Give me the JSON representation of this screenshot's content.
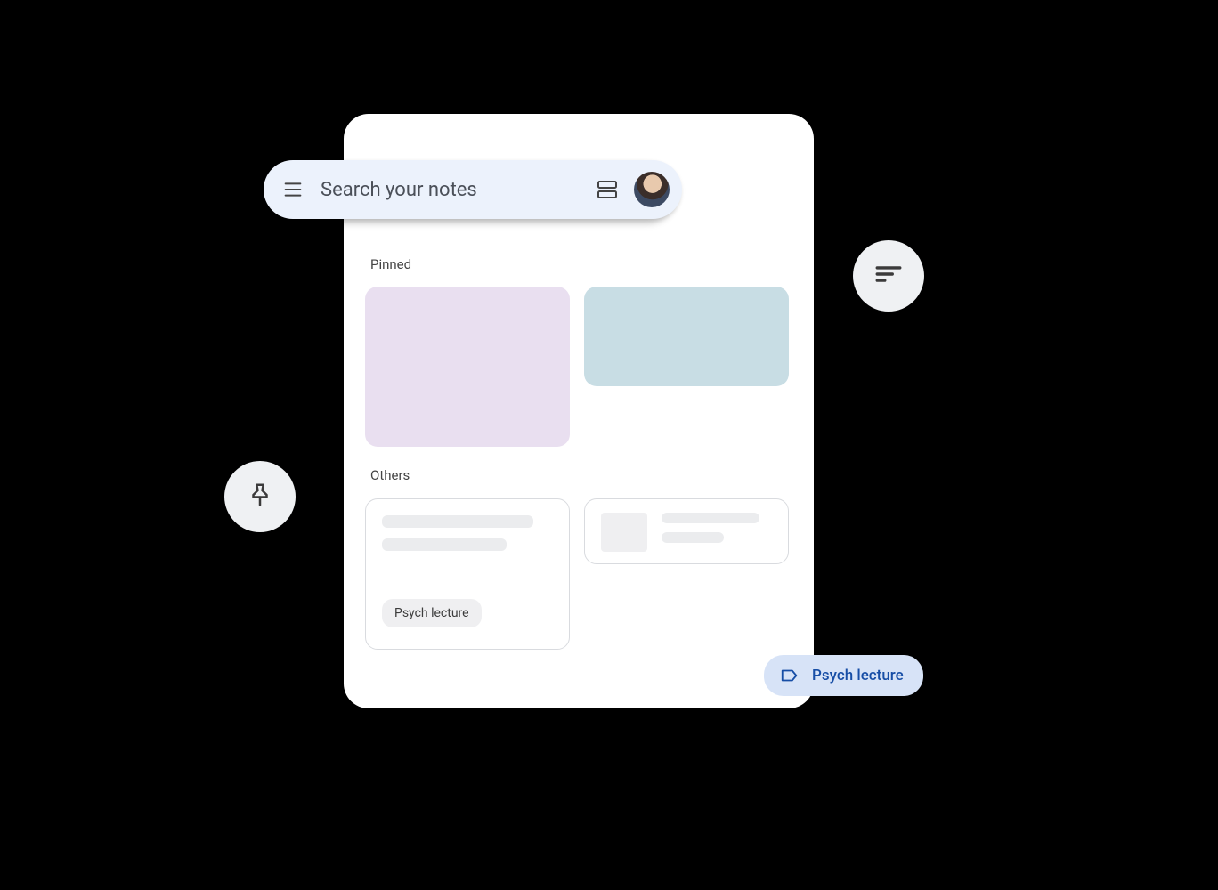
{
  "search": {
    "placeholder": "Search your notes"
  },
  "sections": {
    "pinned": "Pinned",
    "others": "Others"
  },
  "note_tag": "Psych lecture",
  "chip": {
    "label": "Psych lecture"
  },
  "colors": {
    "purple_note": "#e9dff0",
    "blue_note": "#c8dde4",
    "chip_bg": "#d7e3f7",
    "chip_fg": "#174ea6"
  }
}
